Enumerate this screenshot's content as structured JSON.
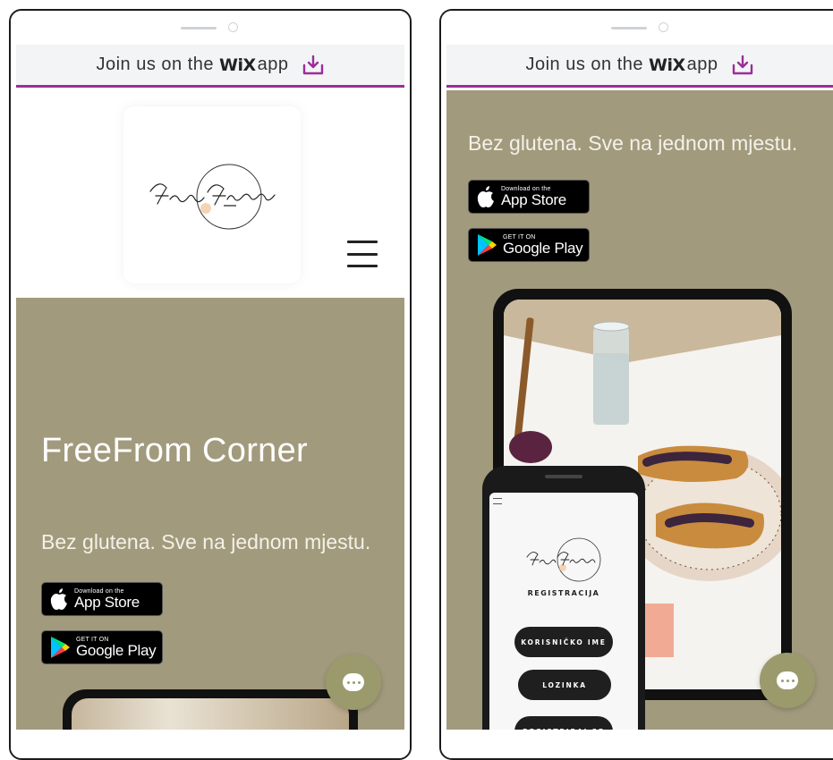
{
  "banner": {
    "prefix": "Join us on the",
    "brand": "WiX",
    "suffix": "app"
  },
  "site": {
    "title": "FreeFrom Corner",
    "tagline": "Bez glutena. Sve na jednom mjestu."
  },
  "app_store": {
    "small": "Download on the",
    "big": "App Store"
  },
  "google_play": {
    "small": "GET IT ON",
    "big": "Google Play"
  },
  "mock_app": {
    "heading": "REGISTRACIJA",
    "buttons": [
      "KORISNIČKO IME",
      "LOZINKA",
      "REGISTRIRAJ SE"
    ]
  },
  "colors": {
    "olive": "#a29a7d",
    "banner_border": "#9b2d9a",
    "chat": "#9b9a6c"
  }
}
